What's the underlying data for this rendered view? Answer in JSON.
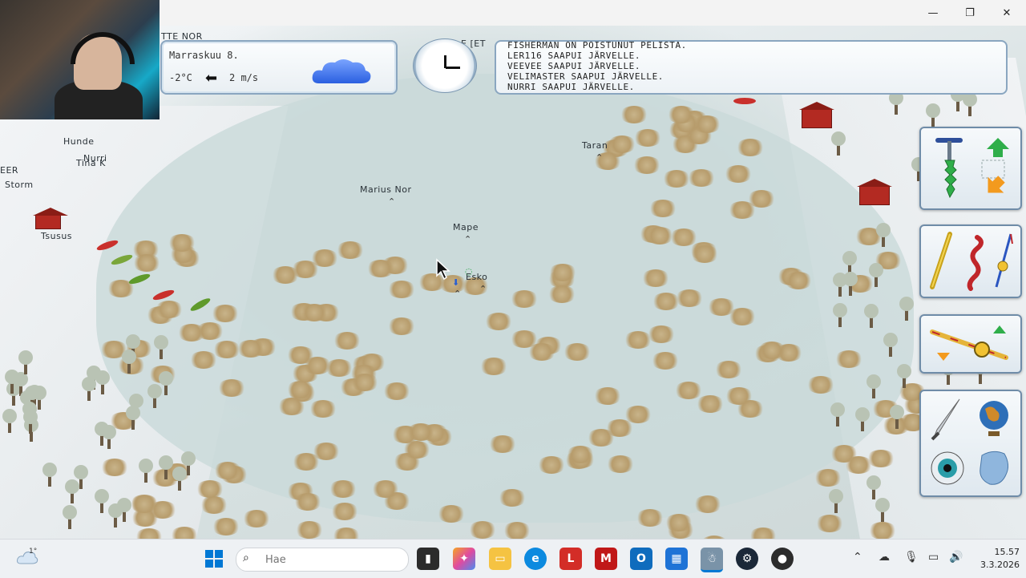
{
  "window": {
    "minimize_label": "—",
    "maximize_label": "❐",
    "close_label": "✕"
  },
  "hud": {
    "weather": {
      "date": "Marraskuu 8.",
      "temperature": "-2°C",
      "wind_speed": "2 m/s",
      "wind_direction_icon": "arrow-left-icon",
      "sky_icon": "cloud-icon"
    },
    "clock_icon": "clock-icon",
    "messages": [
      "FISHERMAN ON POISTUNUT PELISTÄ.",
      "LER116 SAAPUI JÄRVELLE.",
      "VEEVEE SAAPUI JÄRVELLE.",
      "VELIMASTER SAAPUI JÄRVELLE.",
      "NURRI SAAPUI JÄRVELLE."
    ]
  },
  "map": {
    "players": [
      {
        "name": "Taran"
      },
      {
        "name": "Marius Nor"
      },
      {
        "name": "Mape"
      },
      {
        "name": "Esko"
      },
      {
        "name": "Hunde"
      },
      {
        "name": "Nurri"
      },
      {
        "name": "Tina K"
      },
      {
        "name": "Storm"
      },
      {
        "name": "Tsusus"
      }
    ],
    "partial_labels": [
      "TTE NOR",
      "E [ET",
      "EER"
    ]
  },
  "tools": {
    "group1": [
      "ice-auger-icon",
      "move-arrows-icon"
    ],
    "group2": [
      "fishing-rod-gold-icon",
      "worm-bait-icon",
      "jig-rod-icon"
    ],
    "group3": [
      "ice-rod-icon"
    ],
    "group4": [
      "knife-icon",
      "globe-icon",
      "eye-icon",
      "ice-map-icon"
    ]
  },
  "taskbar": {
    "weather_temp": "1°",
    "search_placeholder": "Hae",
    "time": "15.57",
    "date": "3.3.2026",
    "apps": [
      "start-icon",
      "task-view-icon",
      "copilot-icon",
      "file-explorer-icon",
      "edge-icon",
      "lastpass-icon",
      "mcafee-icon",
      "outlook-icon",
      "store-icon",
      "game-icon",
      "steam-icon",
      "obs-icon"
    ],
    "colors": {
      "start": "#0078d4",
      "lastpass": "#d32d27",
      "mcafee": "#c01818",
      "outlook": "#0f6cbd",
      "edge": "#0c8adf",
      "explorer": "#f5c342",
      "steam": "#1b2838"
    }
  }
}
